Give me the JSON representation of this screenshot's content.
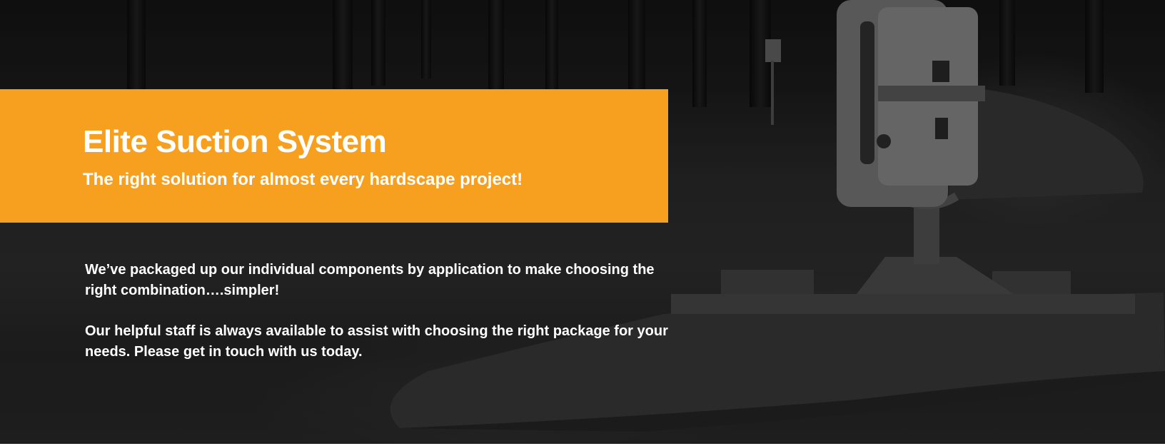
{
  "hero": {
    "title": "Elite Suction System",
    "subtitle": "The right solution for almost every hardscape project!",
    "paragraphs": [
      "We’ve packaged up our individual components by application to make choosing the right combination….simpler!",
      "Our helpful staff is always available to assist with choosing the right package for your needs. Please get in touch with us today."
    ],
    "background_image": "vacuum-lifter-on-stone-slab-photo"
  },
  "colors": {
    "banner": "#f7a020",
    "text": "#ffffff",
    "overlay": "#000000"
  }
}
